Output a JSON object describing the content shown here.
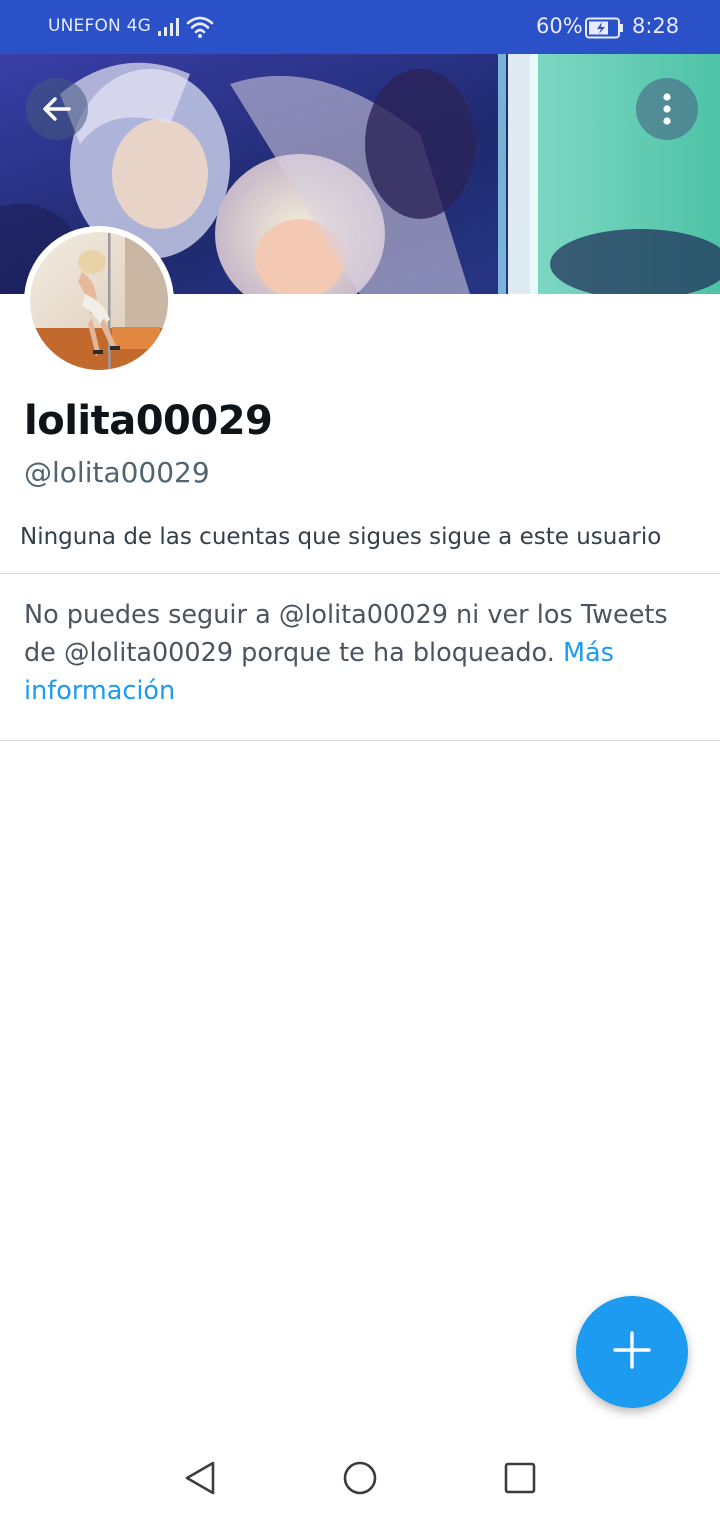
{
  "status_bar": {
    "carrier": "UNEFON 4G",
    "battery_percent": "60%",
    "time": "8:28",
    "icons": [
      "signal-icon",
      "wifi-icon",
      "battery-charging-icon"
    ]
  },
  "header": {
    "icons": [
      "back-arrow-icon",
      "more-vertical-icon"
    ]
  },
  "profile": {
    "display_name": "lolita00029",
    "handle": "@lolita00029",
    "followers_note": "Ninguna de las cuentas que sigues sigue a este usuario"
  },
  "blocked": {
    "message": "No puedes seguir a @lolita00029 ni ver los Tweets de @lolita00029 porque te ha bloqueado. ",
    "link_label": "Más información"
  },
  "fab": {
    "icon": "plus-icon"
  },
  "nav_bar": {
    "icons": [
      "nav-back-icon",
      "nav-home-icon",
      "nav-recents-icon"
    ]
  },
  "colors": {
    "status_bar": "#2b51c8",
    "accent": "#1d9bf0",
    "text_primary": "#0f1419",
    "text_secondary": "#536471"
  }
}
